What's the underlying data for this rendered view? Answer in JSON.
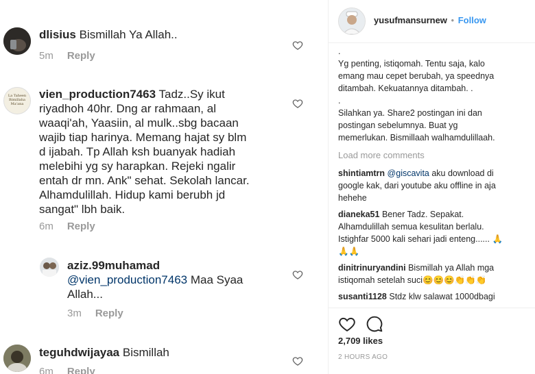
{
  "comments": [
    {
      "username": "dlisius",
      "text": "Bismillah Ya Allah..",
      "time": "5m",
      "reply": "Reply"
    },
    {
      "username": "vien_production7463",
      "text_lines": [
        "Tadz..Sy ikut",
        "riyadhoh 40hr. Dng ar rahmaan, al",
        "waaqi'ah, Yaasiin, al mulk..sbg bacaan",
        "wajib tiap harinya. Memang hajat sy blm",
        "d ijabah. Tp Allah ksh buanyak hadiah",
        "melebihi yg sy harapkan. Rejeki ngalir",
        "entah dr mn. Ank\" sehat. Sekolah lancar.",
        "Alhamdulillah. Hidup kami berubh jd",
        "sangat\" lbh baik."
      ],
      "time": "6m",
      "reply": "Reply",
      "avatar_text": "La Taheen Bimillaha Ma'ana"
    },
    {
      "username": "aziz.99muhamad",
      "mention": "@vien_production7463",
      "text_rest": " Maa Syaa",
      "text_line2": "Allah...",
      "time": "3m",
      "reply": "Reply"
    },
    {
      "username": "teguhdwijayaa",
      "text": "Bismillah",
      "time": "6m",
      "reply": "Reply"
    }
  ],
  "post": {
    "username": "yusufmansurnew",
    "dot": "•",
    "follow": "Follow",
    "caption_lines": [
      ".",
      "Yg penting, istiqomah. Tentu saja, kalo",
      "emang mau cepet berubah, ya speednya",
      "ditambah. Kekuatannya ditambah. .",
      ".",
      "Silahkan ya. Share2 postingan ini dan",
      "postingan sebelumnya. Buat yg",
      "memerlukan. Bismillaah walhamdulillaah."
    ],
    "load_more": "Load more comments",
    "comments": [
      {
        "user": "shintiamtrn",
        "mention": "@giscavita",
        "text_lines": [
          " aku download di",
          "google kak, dari youtube aku offline in aja",
          "hehehe"
        ]
      },
      {
        "user": "dianeka51",
        "text_lines": [
          " Bener Tadz. Sepakat.",
          "Alhamdulillah semua kesulitan berlalu.",
          "Istighfar 5000 kali sehari jadi enteng...... 🙏",
          "🙏🙏"
        ]
      },
      {
        "user": "dinitrinuryandini",
        "text_lines": [
          " Bismillah ya Allah mga",
          "istiqomah setelah suci😊😊😊👏👏👏"
        ]
      },
      {
        "user": "susanti1128",
        "text_lines": [
          " Stdz klw salawat 1000dbagi"
        ]
      }
    ],
    "likes": "2,709 likes",
    "time": "2 HOURS AGO"
  }
}
